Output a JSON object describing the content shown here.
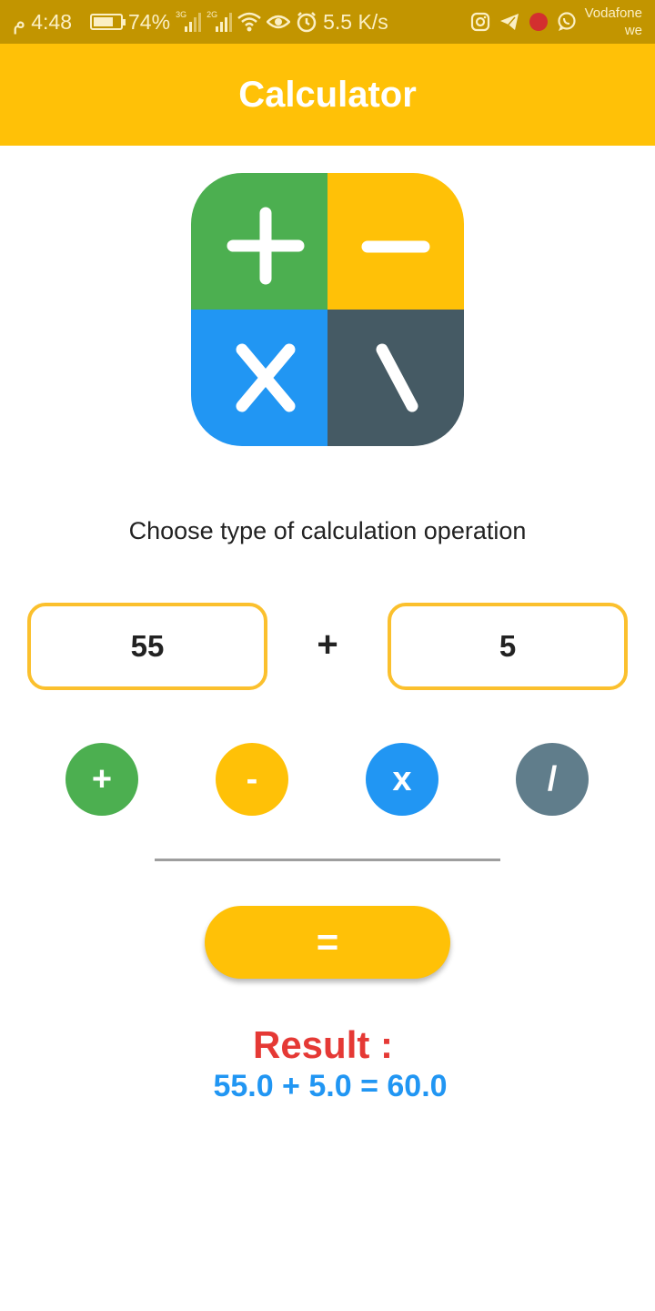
{
  "status_bar": {
    "am_pm": "م",
    "time": "4:48",
    "battery_percent": "74%",
    "battery_level": 0.74,
    "network_1": "3G",
    "network_2": "2G",
    "speed": "5.5 K/s",
    "carrier_line1": "Vodafone",
    "carrier_line2": "we",
    "icons": [
      "instagram-icon",
      "telegram-icon",
      "red-app-icon",
      "whatsapp-icon"
    ]
  },
  "app_bar": {
    "title": "Calculator"
  },
  "logo": {
    "colors": {
      "plus": "#4caf50",
      "minus": "#ffc107",
      "times": "#2196f3",
      "divide": "#455a64"
    }
  },
  "instruction": "Choose type of calculation operation",
  "inputs": {
    "first": "55",
    "second": "5",
    "selected_operator": "+"
  },
  "operators": [
    {
      "label": "+",
      "color": "#4caf50"
    },
    {
      "label": "-",
      "color": "#ffc107"
    },
    {
      "label": "x",
      "color": "#2196f3"
    },
    {
      "label": "/",
      "color": "#607d8b"
    }
  ],
  "equals_label": "=",
  "result": {
    "label": "Result :",
    "expression": "55.0 + 5.0 = 60.0"
  },
  "colors": {
    "accent": "#ffc107",
    "status_bar": "#c29500",
    "result_label": "#e53935",
    "result_value": "#2196f3"
  }
}
